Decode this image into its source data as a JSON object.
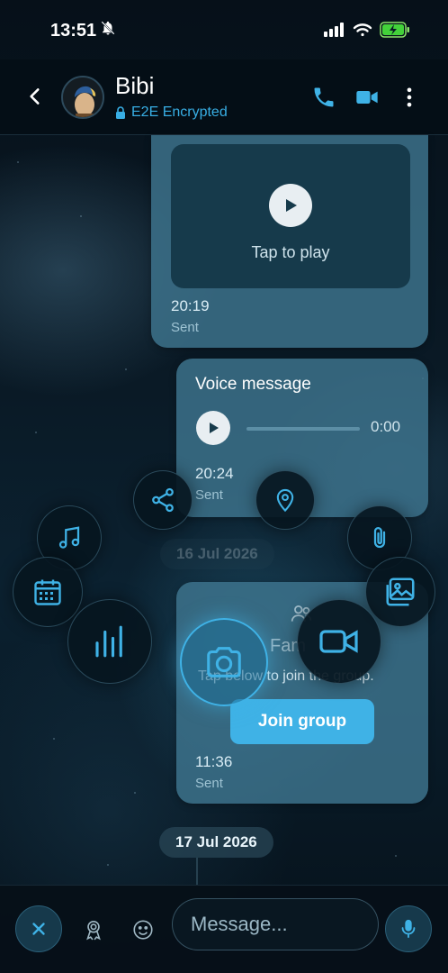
{
  "status_bar": {
    "time": "13:51"
  },
  "header": {
    "contact_name": "Bibi",
    "encryption_label": "E2E Encrypted"
  },
  "messages": {
    "video": {
      "caption": "Tap to play",
      "time": "20:19",
      "status": "Sent"
    },
    "voice": {
      "title": "Voice message",
      "duration": "0:00",
      "time": "20:24",
      "status": "Sent"
    },
    "date_separator_1": "16 Jul 2026",
    "group_invite": {
      "name": "Fam",
      "subtitle": "Tap below to join the group.",
      "join_label": "Join group",
      "time": "11:36",
      "status": "Sent"
    },
    "date_separator_2": "17 Jul 2026"
  },
  "attach_menu": {
    "items": [
      "share-icon",
      "location-icon",
      "music-icon",
      "paperclip-icon",
      "calendar-icon",
      "gallery-icon",
      "poll-icon",
      "camera-icon",
      "video-camera-icon"
    ]
  },
  "input_bar": {
    "placeholder": "Message..."
  },
  "colors": {
    "accent": "#3fb2e6",
    "bubble": "#3e758f",
    "header_bg": "#040e16"
  }
}
